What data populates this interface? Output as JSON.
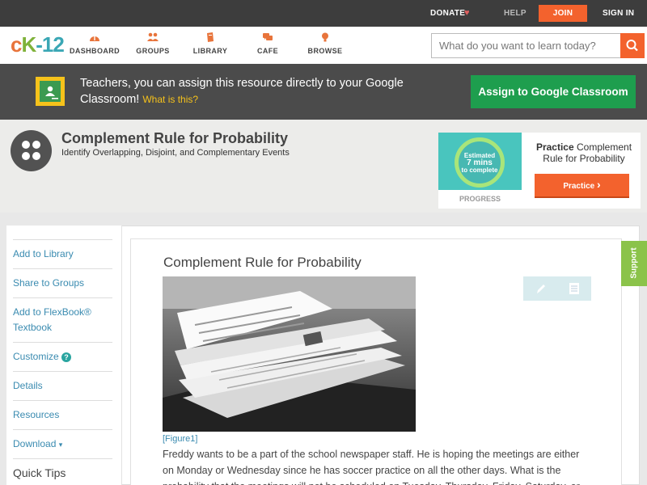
{
  "topbar": {
    "donate": "DONATE",
    "heart": "♥",
    "help": "HELP",
    "join": "JOIN",
    "signin": "SIGN IN"
  },
  "logo": {
    "part1": "c",
    "part2": "K",
    "part3": "-12"
  },
  "nav": [
    {
      "label": "DASHBOARD",
      "icon": "dashboard-icon"
    },
    {
      "label": "GROUPS",
      "icon": "groups-icon"
    },
    {
      "label": "LIBRARY",
      "icon": "library-icon"
    },
    {
      "label": "CAFE",
      "icon": "cafe-icon"
    },
    {
      "label": "BROWSE",
      "icon": "browse-icon"
    }
  ],
  "search": {
    "placeholder": "What do you want to learn today?"
  },
  "google": {
    "text": "Teachers, you can assign this resource directly to your Google Classroom!",
    "link": "What is this?",
    "button": "Assign to Google Classroom"
  },
  "header": {
    "title": "Complement Rule for Probability",
    "subtitle": "Identify Overlapping, Disjoint, and Complementary Events"
  },
  "practice": {
    "estimated": "Estimated",
    "mins": "7 mins",
    "to_complete": "to complete",
    "progress_label": "PROGRESS",
    "title_bold": "Practice",
    "title_rest": "Complement Rule for Probability",
    "button": "Practice",
    "arrow": "›"
  },
  "sidebar": {
    "items": [
      {
        "label": "Add to Library"
      },
      {
        "label": "Share to Groups"
      },
      {
        "label": "Add to FlexBook® Textbook"
      },
      {
        "label": "Customize"
      },
      {
        "label": "Details"
      },
      {
        "label": "Resources"
      },
      {
        "label": "Download"
      }
    ],
    "customize_help": "?",
    "download_caret": "▾",
    "quick_tips": "Quick Tips"
  },
  "article": {
    "title": "Complement Rule for Probability",
    "figure_caption": "[Figure1]",
    "paragraph": "Freddy wants to be a part of the school newspaper staff.  He is hoping the meetings are either on Monday or Wednesday since he has soccer practice on all the other days.  What is the probability that the meetings will not be scheduled on Tuesday, Thursday, Friday, Saturday, or"
  },
  "support": "Support",
  "colors": {
    "accent": "#f3622d",
    "link": "#3a8bb0",
    "google_green": "#1e9e4e",
    "support_green": "#8bc34a"
  }
}
